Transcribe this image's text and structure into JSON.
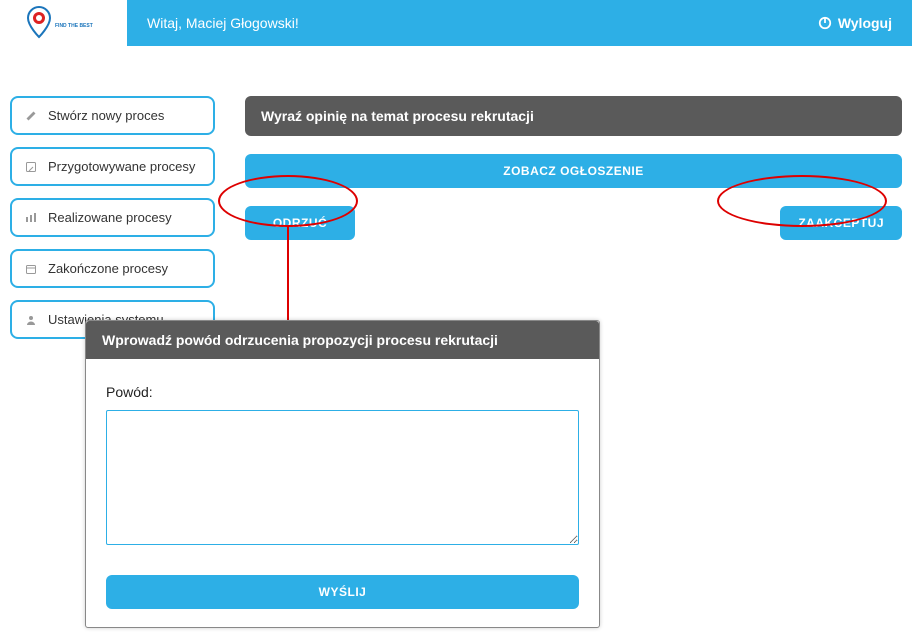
{
  "header": {
    "welcome": "Witaj, Maciej Głogowski!",
    "logout": "Wyloguj",
    "logo_alt": "FIND THE BEST"
  },
  "sidebar": {
    "items": [
      {
        "label": "Stwórz nowy proces",
        "icon": "pencil-icon"
      },
      {
        "label": "Przygotowywane procesy",
        "icon": "edit-list-icon"
      },
      {
        "label": "Realizowane procesy",
        "icon": "progress-icon"
      },
      {
        "label": "Zakończone procesy",
        "icon": "calendar-icon"
      },
      {
        "label": "Ustawienia systemu",
        "icon": "user-icon"
      }
    ]
  },
  "main": {
    "panel_title": "Wyraź opinię na temat procesu rekrutacji",
    "view_ad": "ZOBACZ OGŁOSZENIE",
    "reject": "ODRZUĆ",
    "accept": "ZAAKCEPTUJ"
  },
  "modal": {
    "title": "Wprowadź powód odrzucenia propozycji procesu rekrutacji",
    "reason_label": "Powód:",
    "reason_value": "",
    "send": "WYŚLIJ"
  },
  "colors": {
    "accent": "#2dafe6",
    "annotation": "#d00",
    "panel": "#5a5a5a"
  }
}
